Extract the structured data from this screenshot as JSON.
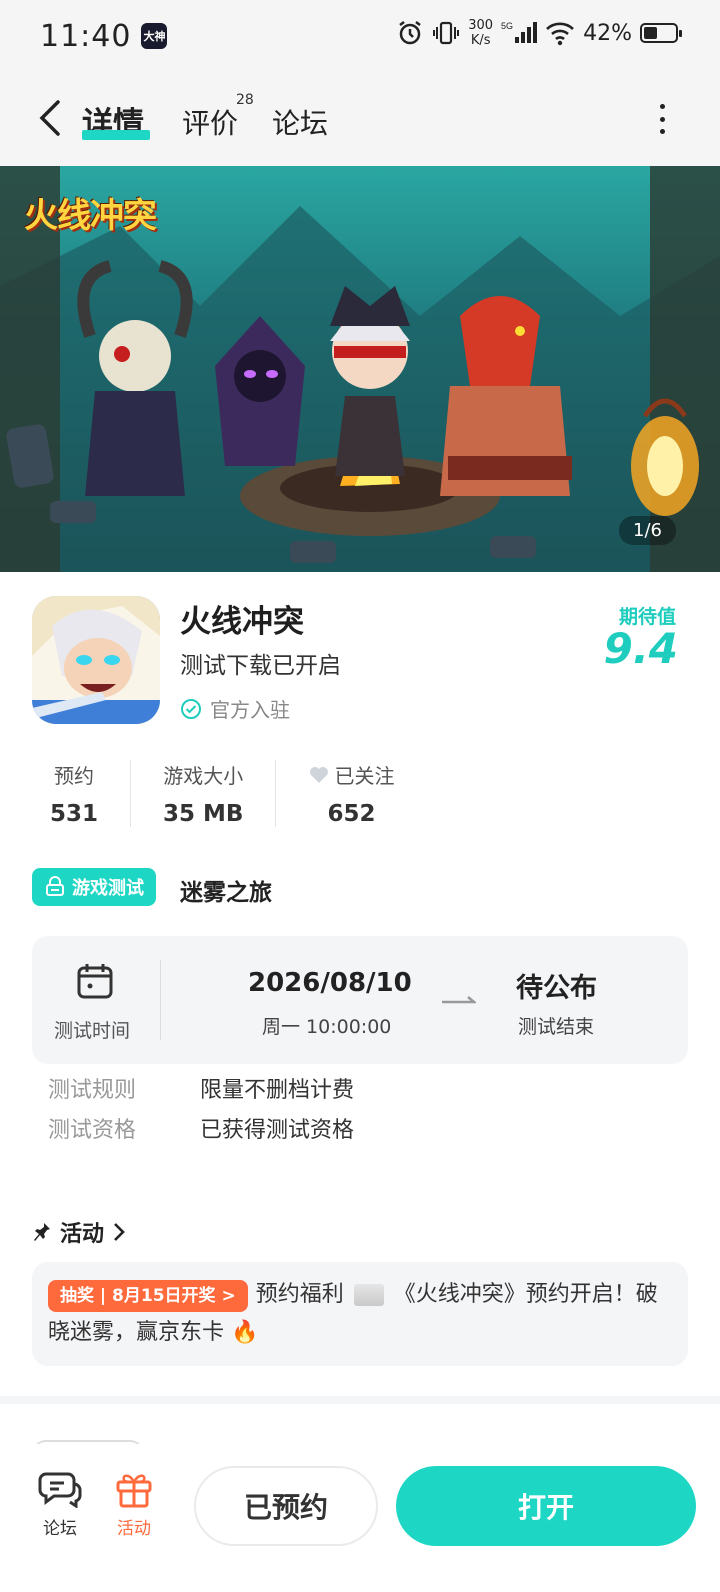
{
  "status_bar": {
    "time": "11:40",
    "app_badge": "大神",
    "net_speed_value": "300",
    "net_speed_unit": "K/s",
    "network": "5G",
    "battery": "42%",
    "battery_level": 0.42,
    "icons": [
      "alarm-icon",
      "vibrate-icon",
      "signal-icon",
      "wifi-icon",
      "battery-icon"
    ]
  },
  "nav": {
    "tabs": [
      {
        "label": "详情",
        "active": true
      },
      {
        "label": "评价",
        "count": "28"
      },
      {
        "label": "论坛"
      }
    ]
  },
  "banner": {
    "logo_text": "火线冲突",
    "counter": "1/6"
  },
  "game": {
    "name": "火线冲突",
    "subtitle": "测试下载已开启",
    "official": "官方入驻",
    "expect_label": "期待值",
    "expect_value": "9.4"
  },
  "stats": [
    {
      "label": "预约",
      "value": "531"
    },
    {
      "label": "游戏大小",
      "value": "35 MB"
    },
    {
      "label": "已关注",
      "value": "652"
    }
  ],
  "test": {
    "tag": "游戏测试",
    "name": "迷雾之旅",
    "time_label": "测试时间",
    "start_date": "2026/08/10",
    "start_detail": "周一  10:00:00",
    "end_value": "待公布",
    "end_label": "测试结束",
    "rules": [
      {
        "key": "测试规则",
        "value": "限量不删档计费"
      },
      {
        "key": "测试资格",
        "value": "已获得测试资格"
      }
    ]
  },
  "activity": {
    "title": "活动",
    "badge": "抽奖 | 8月15日开奖 >",
    "text_part1": "预约福利",
    "text_part2": "《火线冲突》预约开启！破晓迷雾，赢京东卡 🔥"
  },
  "bottom": {
    "forum_label": "论坛",
    "activity_label": "活动",
    "reserved_button": "已预约",
    "open_button": "打开"
  },
  "colors": {
    "accent": "#1ed6c4",
    "activity_orange": "#ff6a3d",
    "card_bg": "#f4f5f7"
  }
}
